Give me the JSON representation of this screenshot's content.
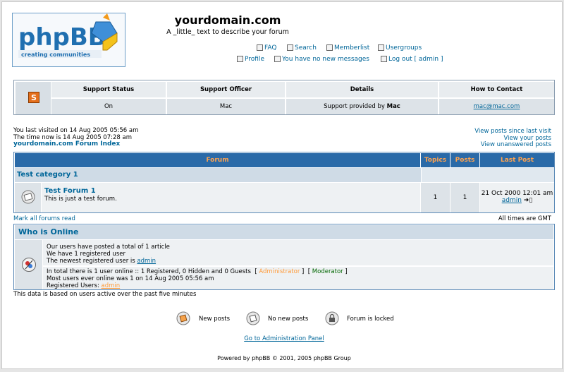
{
  "header": {
    "logo_text": "phpBB",
    "logo_tagline": "creating communities",
    "site_title": "yourdomain.com",
    "site_desc": "A _little_ text to describe your forum",
    "nav": {
      "faq": "FAQ",
      "search": "Search",
      "memberlist": "Memberlist",
      "usergroups": "Usergroups",
      "profile": "Profile",
      "messages": "You have no new messages",
      "logout": "Log out [ admin ]"
    }
  },
  "support": {
    "headers": [
      "Support Status",
      "Support Officer",
      "Details",
      "How to Contact"
    ],
    "status": "On",
    "officer": "Mac",
    "details_prefix": "Support provided by ",
    "details_name": "Mac",
    "contact": "mac@mac.com",
    "icon_letter": "S"
  },
  "info": {
    "last_visit": "You last visited on 14 Aug 2005 05:56 am",
    "time_now": "The time now is 14 Aug 2005 07:28 am",
    "index_link": "yourdomain.com Forum Index",
    "view_since": "View posts since last visit",
    "view_yours": "View your posts",
    "view_unanswered": "View unanswered posts"
  },
  "forum_table": {
    "headers": {
      "forum": "Forum",
      "topics": "Topics",
      "posts": "Posts",
      "last_post": "Last Post"
    },
    "category": "Test category 1",
    "forum_name": "Test Forum 1",
    "forum_desc": "This is just a test forum.",
    "topics": "1",
    "posts": "1",
    "last_post_date": "21 Oct 2000 12:01 am",
    "last_post_user": "admin"
  },
  "mark_read": "Mark all forums read",
  "timezone": "All times are GMT",
  "who": {
    "title": "Who is Online",
    "line1": "Our users have posted a total of 1 article",
    "line2": "We have 1 registered user",
    "line3_prefix": "The newest registered user is ",
    "line3_user": "admin",
    "line4_prefix": "In total there is 1 user online :: 1 Registered, 0 Hidden and 0 Guests",
    "administrator": "Administrator",
    "moderator": "Moderator",
    "line5": "Most users ever online was 1 on 14 Aug 2005 05:56 am",
    "line6_prefix": "Registered Users: ",
    "line6_user": "admin"
  },
  "data_note": "This data is based on users active over the past five minutes",
  "legend": {
    "new_posts": "New posts",
    "no_new_posts": "No new posts",
    "locked": "Forum is locked"
  },
  "admin_panel": "Go to Administration Panel",
  "footer": "Powered by phpBB © 2001, 2005 phpBB Group",
  "colors": {
    "accent": "#006699",
    "header_bar": "#2a6aa8",
    "header_text": "#ffa34f",
    "admin_color": "#ff9b3a",
    "mod_color": "#006600"
  }
}
